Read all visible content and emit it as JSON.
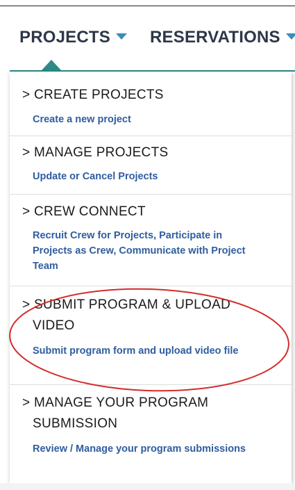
{
  "nav": {
    "projects_label": "PROJECTS",
    "reservations_label": "RESERVATIONS"
  },
  "menu": {
    "items": [
      {
        "title": "> CREATE PROJECTS",
        "desc": "Create a new project"
      },
      {
        "title": "> MANAGE PROJECTS",
        "desc": "Update or Cancel Projects"
      },
      {
        "title": "> CREW CONNECT",
        "desc": "Recruit Crew for Projects, Participate in Projects as Crew, Communicate with Project Team"
      },
      {
        "title_line1": "> SUBMIT PROGRAM & UPLOAD",
        "title_line2": "VIDEO",
        "desc": "Submit program form and upload video file"
      },
      {
        "title_line1": "> MANAGE YOUR PROGRAM",
        "title_line2": "SUBMISSION",
        "desc": "Review / Manage your program submissions"
      }
    ]
  },
  "colors": {
    "accent": "#2c8b85",
    "caret": "#3a8bbf",
    "link": "#2f5d9e",
    "annotation": "#d42a2a"
  },
  "icons": {
    "caret": "caret-down-icon",
    "pointer": "dropdown-pointer-icon"
  }
}
